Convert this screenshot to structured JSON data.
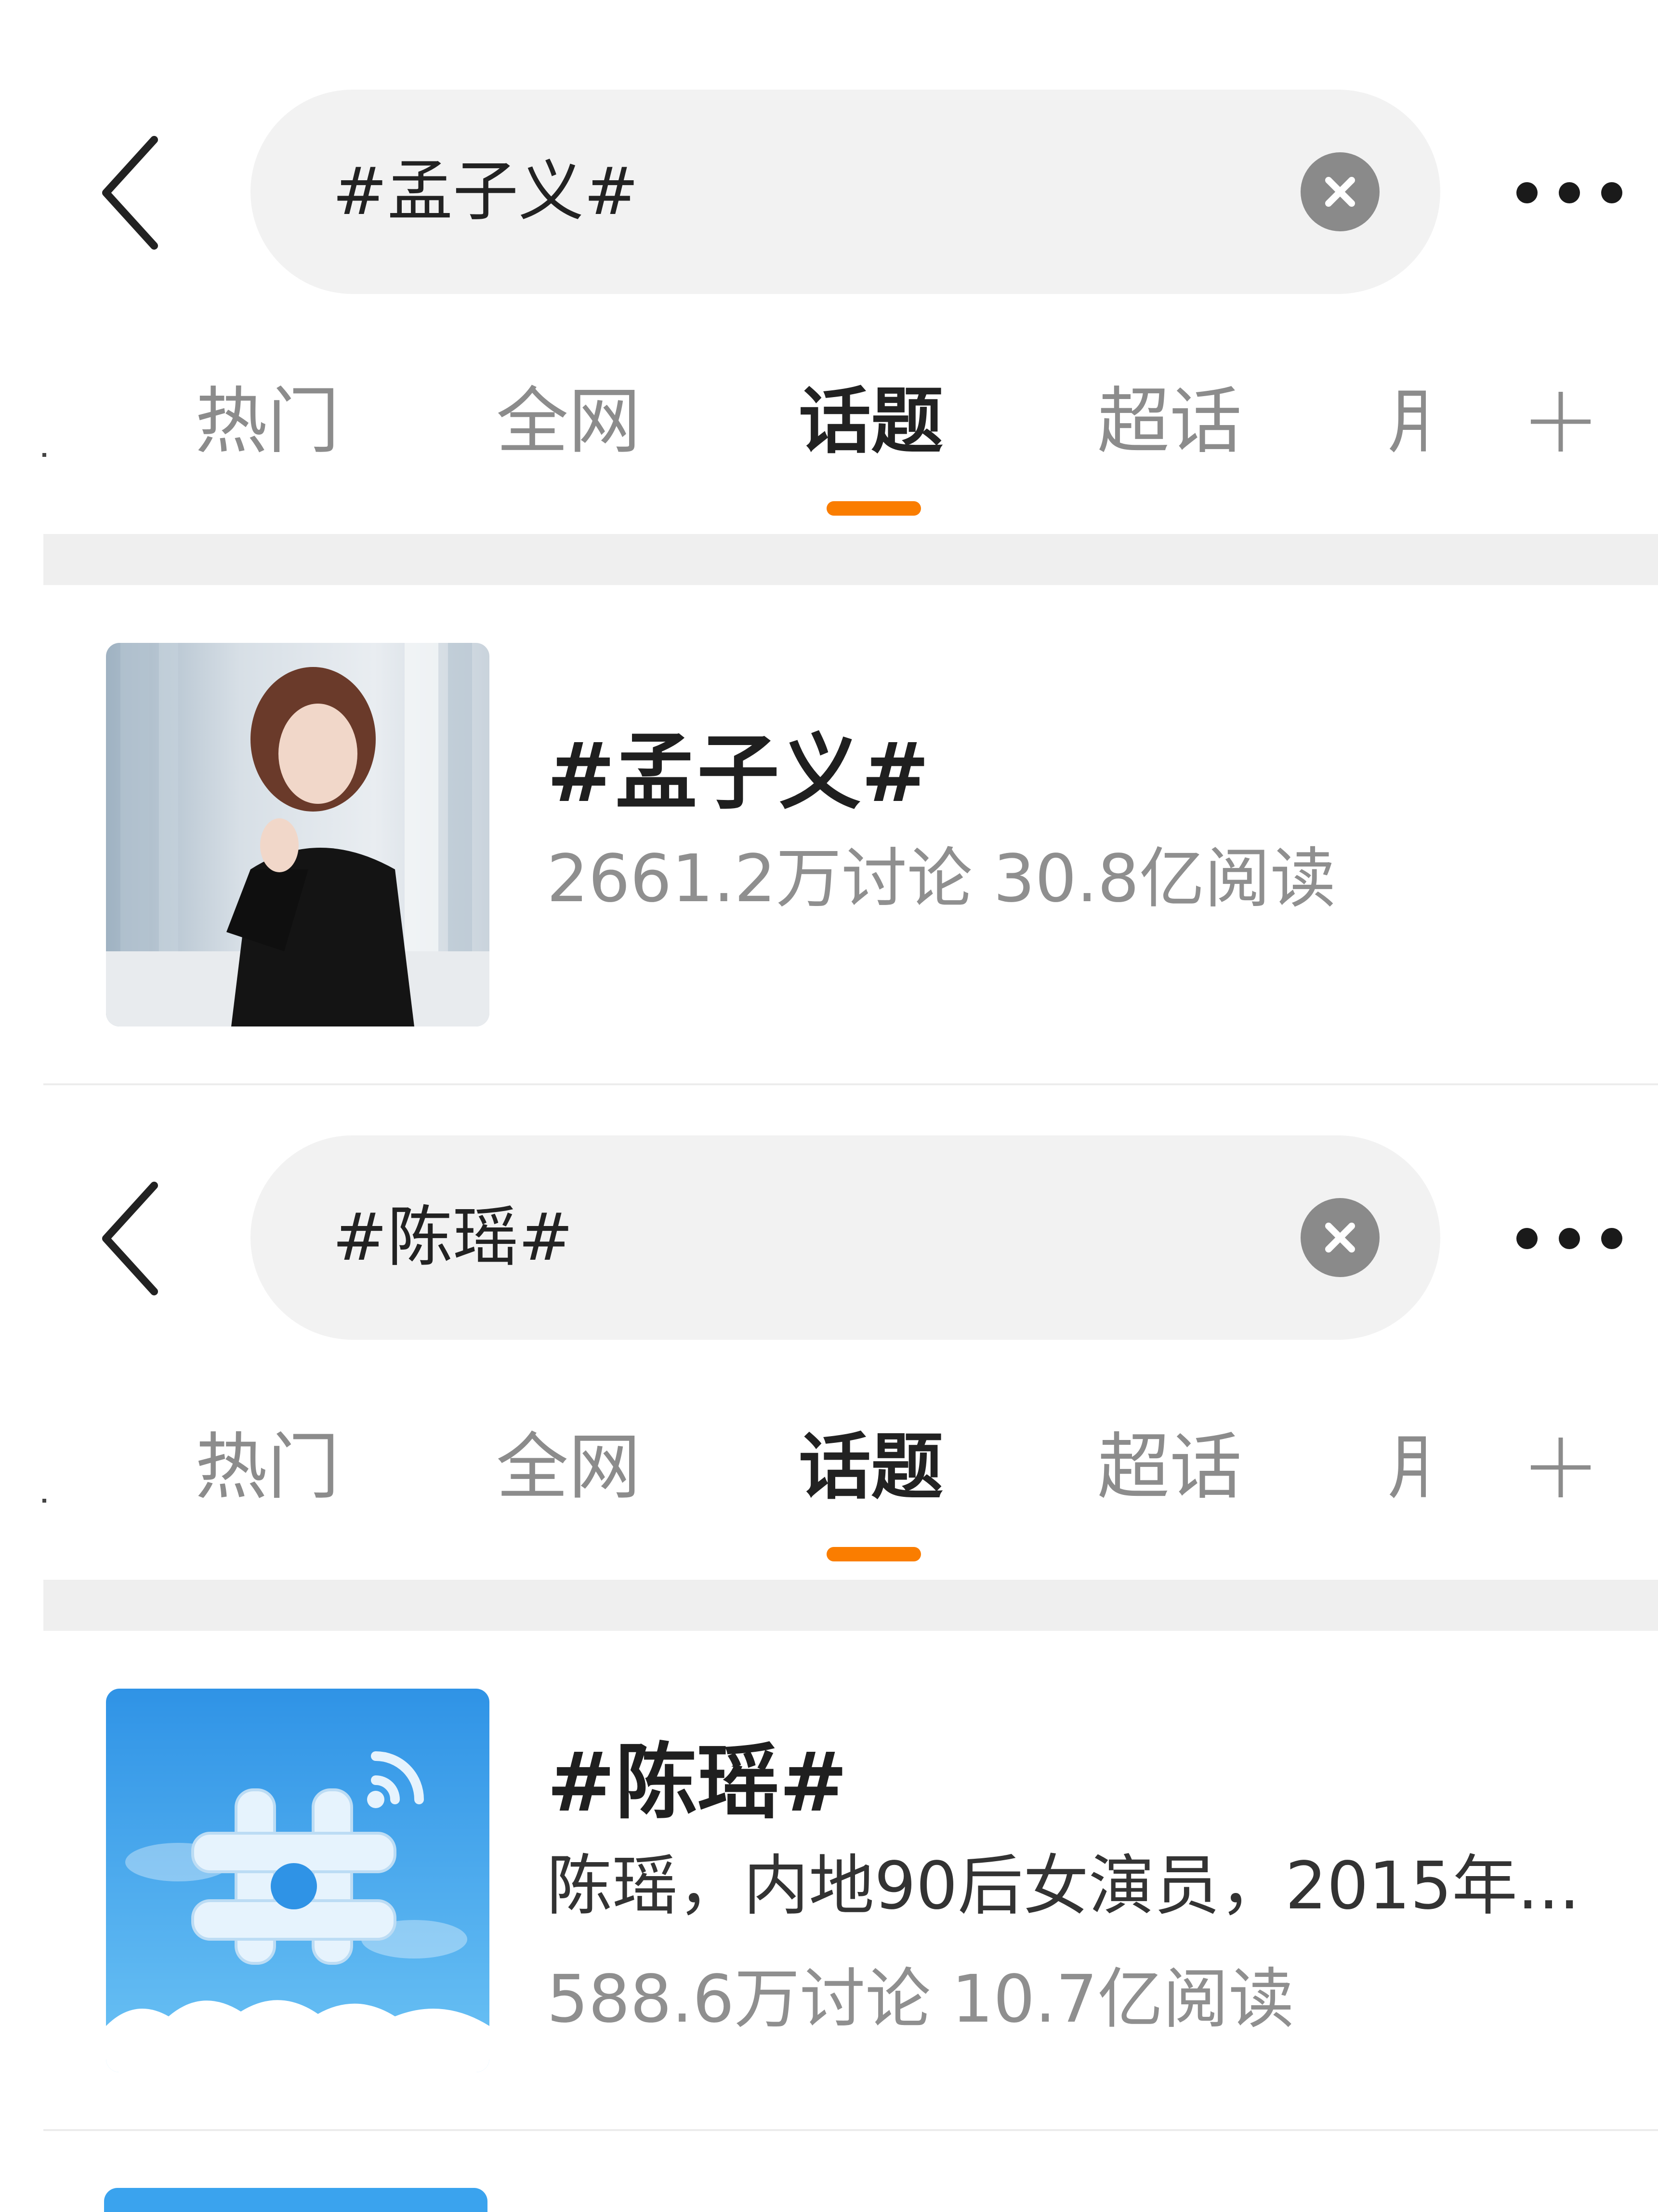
{
  "screens": [
    {
      "search": {
        "query": "#孟子义#"
      },
      "tabs": [
        "热门",
        "全网",
        "话题",
        "超话",
        "+"
      ],
      "tabs_partial": "用",
      "active_tab": "话题",
      "result": {
        "title": "#孟子义#",
        "stats": "2661.2万讨论 30.8亿阅读",
        "thumbnail": "portrait-photo"
      }
    },
    {
      "search": {
        "query": "#陈瑶#"
      },
      "tabs": [
        "热门",
        "全网",
        "话题",
        "超话",
        "+"
      ],
      "tabs_partial": "用",
      "active_tab": "话题",
      "result": {
        "title": "#陈瑶#",
        "description": "陈瑶，内地90后女演员，2015年...",
        "stats": "588.6万讨论 10.7亿阅读",
        "thumbnail": "topic-hash-icon"
      }
    }
  ],
  "icons": {
    "back": "chevron-left-icon",
    "clear": "clear-icon",
    "more": "more-icon",
    "add": "plus-icon"
  },
  "colors": {
    "accent": "#fa7d00",
    "search_bg": "#f2f2f2",
    "stats_text": "#8f8f8f",
    "inactive_tab": "#8c8c8c",
    "topic_icon_bg": "#3aa3ee"
  }
}
